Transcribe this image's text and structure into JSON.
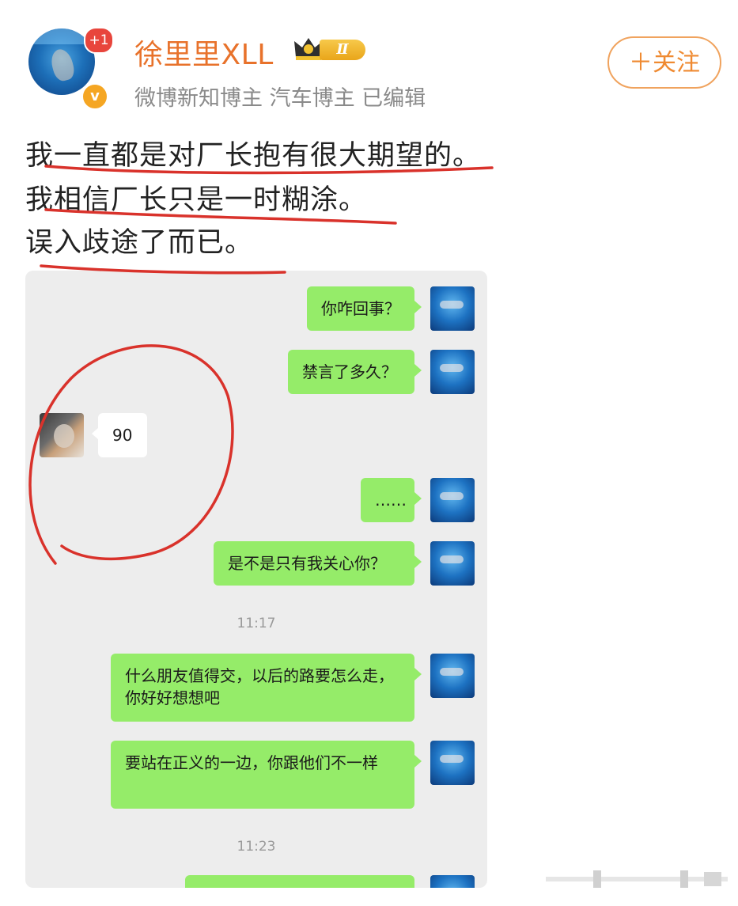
{
  "header": {
    "username": "徐里里XLL",
    "notification_count": "+1",
    "verified_mark": "v",
    "level_label": "Ⅱ",
    "subtitle": "微博新知博主 汽车博主  已编辑",
    "follow_label": "＋关注"
  },
  "post": {
    "lines": [
      "我一直都是对厂长抱有很大期望的。",
      "我相信厂长只是一时糊涂。",
      "误入歧途了而已。"
    ]
  },
  "chat": {
    "messages": [
      {
        "side": "right",
        "text": "你咋回事？"
      },
      {
        "side": "right",
        "text": "禁言了多久？"
      },
      {
        "side": "left",
        "text": "90"
      },
      {
        "side": "right",
        "text": "……"
      },
      {
        "side": "right",
        "text": "是不是只有我关心你？"
      },
      {
        "type": "time",
        "text": "11:17"
      },
      {
        "side": "right",
        "text": "什么朋友值得交，以后的路要怎么走，你好好想想吧"
      },
      {
        "side": "right",
        "text": "要站在正义的一边，你跟他们不一样"
      },
      {
        "type": "time",
        "text": "11:23"
      }
    ]
  },
  "colors": {
    "username": "#e8722b",
    "follow_border": "#f0a35e",
    "bubble_green": "#95ec69",
    "chat_bg": "#ededed",
    "annotation_red": "#d9322b"
  },
  "icons": [
    "avatar-image",
    "crown-icon",
    "verified-v-icon",
    "plus-icon"
  ]
}
